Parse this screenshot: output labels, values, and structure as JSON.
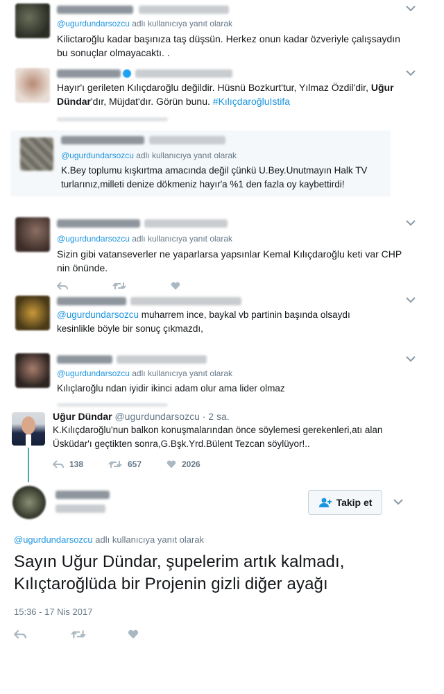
{
  "reply1": {
    "replying_mention": "@ugurdundarsozcu",
    "replying_suffix": " adlı kullanıcıya yanıt olarak",
    "line1": "Kilictaroğlu kadar başınıza taş düşsün. Herkez onun kadar özveriyle çalışsaydın",
    "line2": "bu sonuçlar olmayacaktı. ."
  },
  "reply2": {
    "line1a": "Hayır'ı gerileten Kılıçdaroğlu değildir. Hüsnü Bozkurt'tur, Yılmaz Özdil'dir, ",
    "line1b": "Uğur",
    "line2a": "Dündar",
    "line2b": "'dır, Müjdat'dır. Görün bunu. ",
    "hashtag": "#KılıçdaroğluIstifa"
  },
  "reply3": {
    "replying_mention": "@ugurdundarsozcu",
    "replying_suffix": " adlı kullanıcıya yanıt olarak",
    "line1": "K.Bey toplumu kışkırtma amacında değil çünkü U.Bey.Unutmayın Halk TV",
    "line2": "turlarınız,milleti denize dökmeniz hayır'a %1 den fazla oy kaybettirdi!"
  },
  "reply4": {
    "replying_mention": "@ugurdundarsozcu",
    "replying_suffix": " adlı kullanıcıya yanıt olarak",
    "line1": "Sizin gibi vatanseverler ne yaparlarsa yapsınlar Kemal Kılıçdaroğlu keti var CHP",
    "line2": "nin önünde."
  },
  "reply5": {
    "mention": "@ugurdundarsozcu",
    "line1": " muharrem ince, baykal  vb partinin başında olsaydı",
    "line2": "kesinlikle böyle bir sonuç çıkmazdı,"
  },
  "reply6": {
    "replying_mention": "@ugurdundarsozcu",
    "replying_suffix": " adlı kullanıcıya yanıt olarak",
    "line1": "Kılıçlaroğlu ndan iyidir ikinci adam olur ama lider olmaz"
  },
  "parent": {
    "name": "Uğur Dündar",
    "handle": "@ugurdundarsozcu",
    "time": " · 2 sa.",
    "line1": "K.Kılıçdaroğlu'nun balkon konuşmalarından önce söylemesi gerekenleri,atı alan",
    "line2": "Üsküdar'ı geçtikten sonra,G.Bşk.Yrd.Bülent Tezcan söylüyor!..",
    "replies": "138",
    "retweets": "657",
    "likes": "2026"
  },
  "follow": {
    "label": "Takip et"
  },
  "main": {
    "replying_mention": "@ugurdundarsozcu",
    "replying_suffix": " adlı kullanıcıya yanıt olarak",
    "line1": "Sayın Uğur Dündar, şupelerim artık kalmadı,",
    "line2": "Kılıçtaroğlüda bir Projenin gizli diğer ayağı",
    "timestamp": "15:36 - 17 Nis 2017"
  },
  "colors": {
    "link": "#1b95e0",
    "muted": "#657786",
    "text": "#14171a",
    "accent_line": "#4ba8a0"
  },
  "icons": [
    "chevron-down-icon",
    "reply-icon",
    "retweet-icon",
    "heart-icon",
    "follow-user-icon"
  ]
}
